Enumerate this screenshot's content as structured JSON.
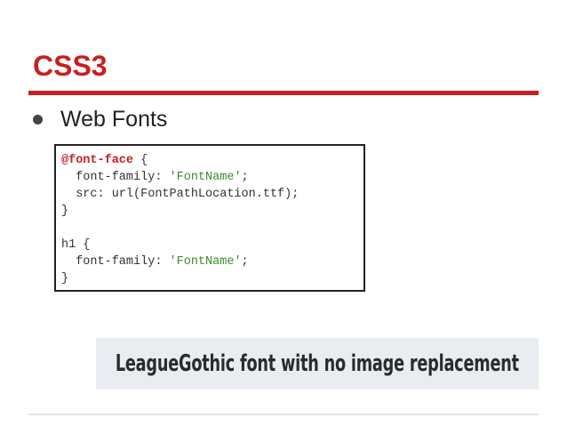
{
  "slide": {
    "title": "CSS3",
    "accent_color": "#c8201f",
    "bullet": "Web Fonts"
  },
  "code": {
    "line1_keyword": "@font-face",
    "line1_rest": " {",
    "line2_prop": "  font-family: ",
    "line2_value": "'FontName'",
    "line2_end": ";",
    "line3": "  src: url(FontPathLocation.ttf);",
    "line4": "}",
    "line5": "",
    "line6": "h1 {",
    "line7_prop": "  font-family: ",
    "line7_value": "'FontName'",
    "line7_end": ";",
    "line8": "}",
    "keyword_color": "#c8201f",
    "string_color": "#3d8b2f"
  },
  "banner": {
    "text": "LeagueGothic font with no image replacement"
  }
}
